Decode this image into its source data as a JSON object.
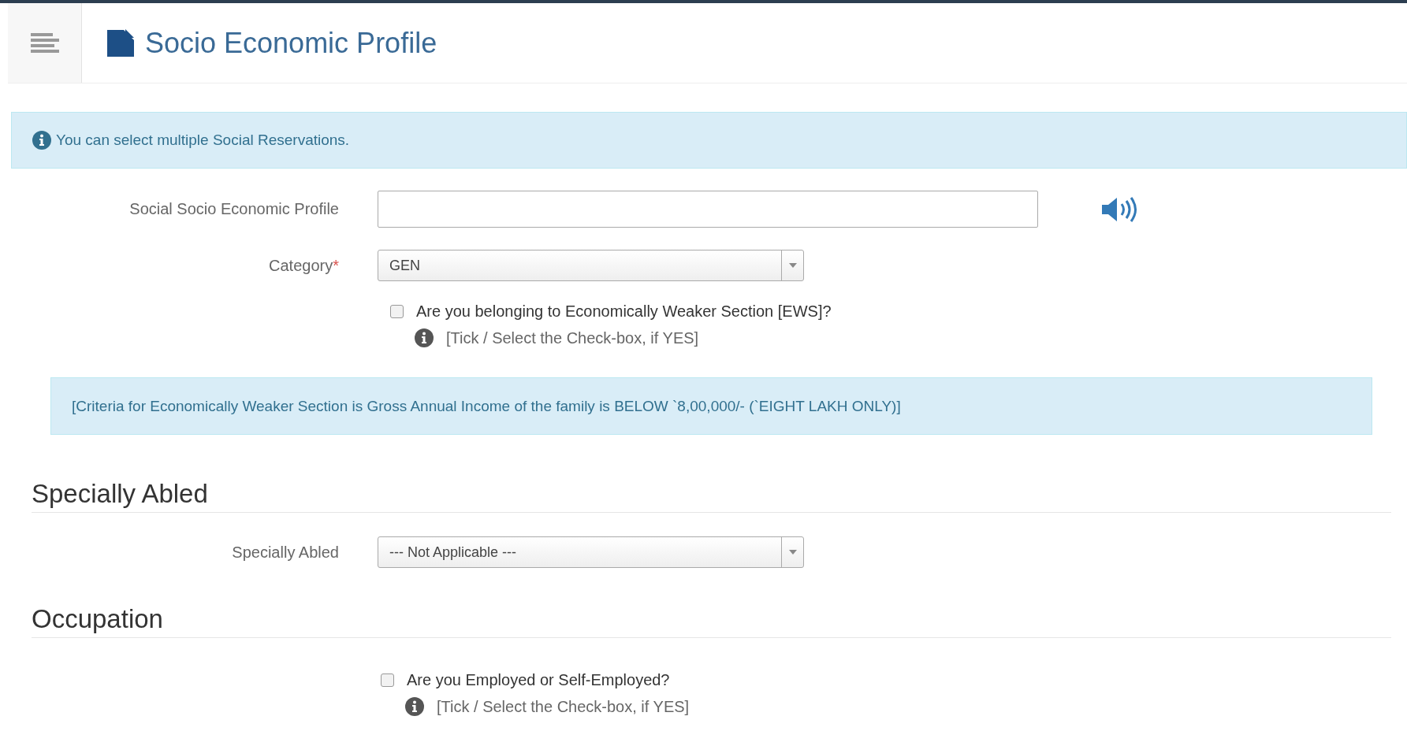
{
  "header": {
    "title": "Socio Economic Profile"
  },
  "alert": {
    "text": "You can select multiple Social Reservations."
  },
  "profile": {
    "label": "Social Socio Economic Profile"
  },
  "category": {
    "label": "Category",
    "required_mark": "*",
    "value": "GEN"
  },
  "ews": {
    "label": "Are you belonging to Economically Weaker Section [EWS]?",
    "checked": false,
    "hint": "[Tick / Select the Check-box, if YES]"
  },
  "criteria": {
    "text": "[Criteria for Economically Weaker Section is Gross Annual Income of the family is BELOW `8,00,000/- (`EIGHT LAKH ONLY)]"
  },
  "specially_abled": {
    "heading": "Specially Abled",
    "label": "Specially Abled",
    "value": "--- Not Applicable ---"
  },
  "occupation": {
    "heading": "Occupation",
    "label": "Are you Employed or Self-Employed?",
    "checked": false,
    "hint": "[Tick / Select the Check-box, if YES]"
  }
}
